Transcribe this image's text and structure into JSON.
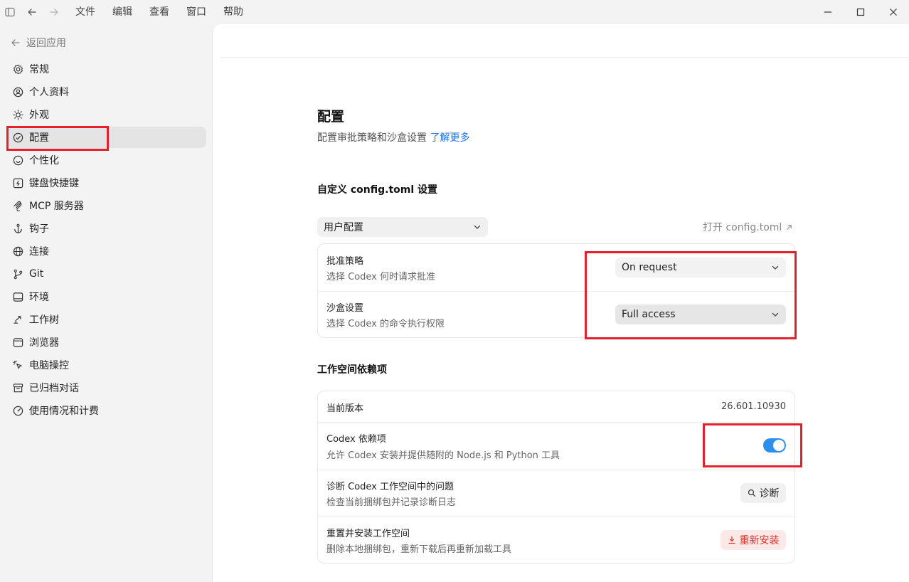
{
  "menu": [
    "文件",
    "编辑",
    "查看",
    "窗口",
    "帮助"
  ],
  "sidebar": {
    "back_label": "返回应用",
    "items": [
      {
        "label": "常规",
        "icon": "gear-icon"
      },
      {
        "label": "个人资料",
        "icon": "user-icon"
      },
      {
        "label": "外观",
        "icon": "sun-icon"
      },
      {
        "label": "配置",
        "icon": "shield-icon"
      },
      {
        "label": "个性化",
        "icon": "smile-icon"
      },
      {
        "label": "键盘快捷键",
        "icon": "keyboard-icon"
      },
      {
        "label": "MCP 服务器",
        "icon": "mcp-icon"
      },
      {
        "label": "钩子",
        "icon": "anchor-icon"
      },
      {
        "label": "连接",
        "icon": "globe-icon"
      },
      {
        "label": "Git",
        "icon": "git-branch-icon"
      },
      {
        "label": "环境",
        "icon": "monitor-icon"
      },
      {
        "label": "工作树",
        "icon": "worktree-icon"
      },
      {
        "label": "浏览器",
        "icon": "browser-icon"
      },
      {
        "label": "电脑操控",
        "icon": "computer-control-icon"
      },
      {
        "label": "已归档对话",
        "icon": "archive-icon"
      },
      {
        "label": "使用情况和计费",
        "icon": "gauge-icon"
      }
    ],
    "active_index": 3
  },
  "page": {
    "title": "配置",
    "subtitle": "配置审批策略和沙盒设置",
    "learn_more": "了解更多",
    "config_section": "自定义 config.toml 设置",
    "scope_select": "用户配置",
    "open_config": "打开 config.toml",
    "approval": {
      "title": "批准策略",
      "desc": "选择 Codex 何时请求批准",
      "value": "On request"
    },
    "sandbox": {
      "title": "沙盒设置",
      "desc": "选择 Codex 的命令执行权限",
      "value": "Full access"
    },
    "deps_section": "工作空间依赖项",
    "version": {
      "title": "当前版本",
      "value": "26.601.10930"
    },
    "codex_deps": {
      "title": "Codex 依赖项",
      "desc": "允许 Codex 安装并提供随附的 Node.js 和 Python 工具",
      "enabled": true
    },
    "diagnose": {
      "title": "诊断 Codex 工作空间中的问题",
      "desc": "检查当前捆绑包并记录诊断日志",
      "button": "诊断"
    },
    "reinstall": {
      "title": "重置并安装工作空间",
      "desc": "删除本地捆绑包，重新下载后再重新加载工具",
      "button": "重新安装"
    }
  },
  "colors": {
    "accent": "#2b8ef0",
    "highlight": "#e4202a",
    "danger": "#d93025",
    "link": "#1a73e8"
  }
}
